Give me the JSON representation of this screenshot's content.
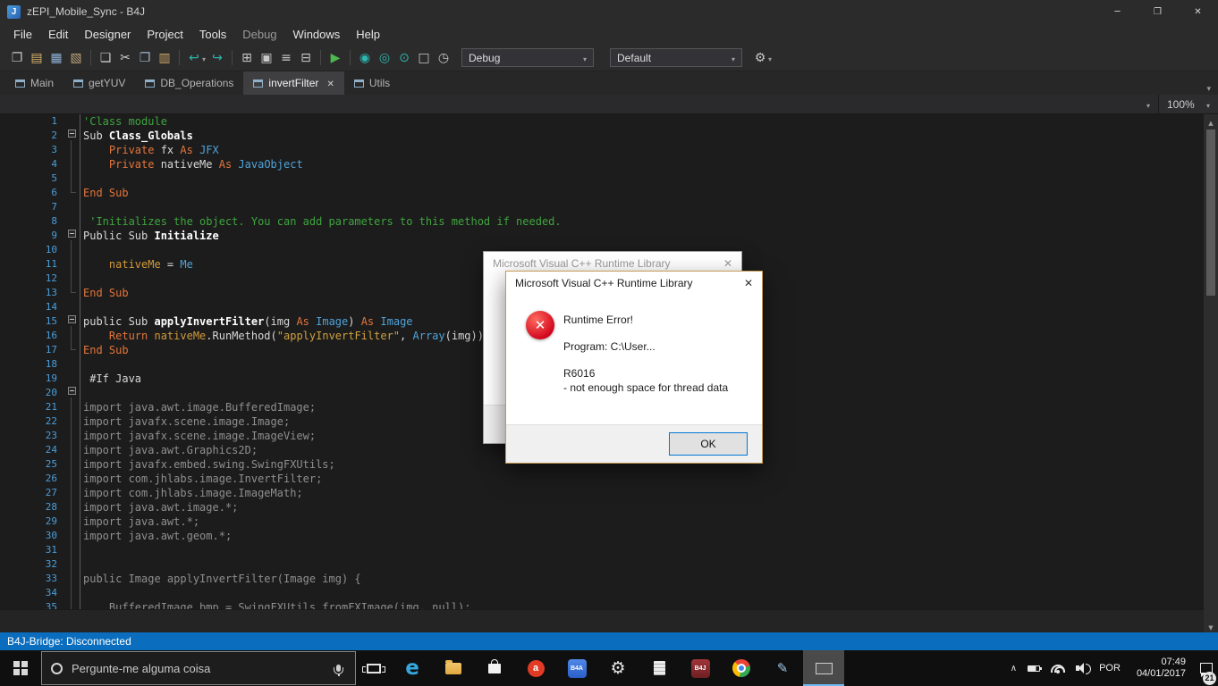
{
  "window": {
    "title": "zEPI_Mobile_Sync - B4J",
    "icon_letter": "J",
    "controls": [
      {
        "name": "minimize-icon",
        "glyph": "─"
      },
      {
        "name": "restore-icon",
        "glyph": "❐"
      },
      {
        "name": "close-icon",
        "glyph": "✕"
      }
    ]
  },
  "menu": {
    "items": [
      {
        "label": "File"
      },
      {
        "label": "Edit"
      },
      {
        "label": "Designer"
      },
      {
        "label": "Project"
      },
      {
        "label": "Tools"
      },
      {
        "label": "Debug",
        "dimmed": true
      },
      {
        "label": "Windows"
      },
      {
        "label": "Help"
      }
    ]
  },
  "toolbar": {
    "debug_value": "Debug",
    "default_value": "Default",
    "left": [
      {
        "name": "new-project-icon",
        "glyph": "❐",
        "color": "#c8c8c8"
      },
      {
        "name": "open-project-icon",
        "glyph": "▤",
        "color": "#d9b26a"
      },
      {
        "name": "save-icon",
        "glyph": "▦",
        "color": "#8fb3d9"
      },
      {
        "name": "export-icon",
        "glyph": "▧",
        "color": "#bda57a"
      },
      {
        "sep": true
      },
      {
        "name": "modules-icon",
        "glyph": "❏",
        "color": "#c8c8c8"
      },
      {
        "name": "cut-icon",
        "glyph": "✂",
        "color": "#cfcfcf"
      },
      {
        "name": "copy-icon",
        "glyph": "❐",
        "color": "#9fb6cc"
      },
      {
        "name": "paste-icon",
        "glyph": "▥",
        "color": "#cfa96a"
      },
      {
        "sep": true
      },
      {
        "name": "navigate-back-icon",
        "glyph": "↩",
        "color": "#2fb5ae",
        "caret": true
      },
      {
        "name": "navigate-forward-icon",
        "glyph": "↪",
        "color": "#2fb5ae"
      },
      {
        "sep": true
      },
      {
        "name": "designer-icon",
        "glyph": "⊞",
        "color": "#c8c8c8"
      },
      {
        "name": "layout-icon",
        "glyph": "▣",
        "color": "#c8c8c8"
      },
      {
        "name": "logs-icon",
        "glyph": "≡",
        "color": "#c8c8c8"
      },
      {
        "name": "compile-icon",
        "glyph": "⊟",
        "color": "#c8c8c8"
      },
      {
        "sep": true
      },
      {
        "name": "run-icon",
        "glyph": "▶",
        "color": "#4db84d"
      },
      {
        "sep": true
      },
      {
        "name": "bridge-icon",
        "glyph": "◉",
        "color": "#2fb5ae"
      },
      {
        "name": "connect-icon",
        "glyph": "◎",
        "color": "#2fb5ae"
      },
      {
        "name": "wireless-icon",
        "glyph": "⊙",
        "color": "#2fb5ae"
      },
      {
        "name": "stop-icon",
        "glyph": "□",
        "color": "#c8c8c8"
      },
      {
        "name": "profiler-icon",
        "glyph": "◷",
        "color": "#c8c8c8"
      }
    ],
    "right": [
      {
        "name": "tools-gear-icon",
        "glyph": "⚙",
        "color": "#c8c8c8",
        "caret": true
      }
    ]
  },
  "tabs": [
    {
      "label": "Main"
    },
    {
      "label": "getYUV"
    },
    {
      "label": "DB_Operations"
    },
    {
      "label": "invertFilter",
      "active": true,
      "closable": true
    },
    {
      "label": "Utils"
    }
  ],
  "navbar": {
    "zoom": "100%"
  },
  "editor": {
    "fold_guides": [
      {
        "from": 2,
        "to": 6
      },
      {
        "from": 9,
        "to": 13
      },
      {
        "from": 15,
        "to": 17
      },
      {
        "from": 20
      }
    ],
    "lines": [
      {
        "n": 1,
        "s": [
          [
            "cm",
            "'Class module"
          ]
        ]
      },
      {
        "n": 2,
        "fold": true,
        "s": [
          [
            "pl",
            "Sub "
          ],
          [
            "bd",
            "Class_Globals"
          ]
        ]
      },
      {
        "n": 3,
        "s": [
          [
            "pl",
            "    "
          ],
          [
            "kw",
            "Private "
          ],
          [
            "pl",
            "fx "
          ],
          [
            "kw",
            "As "
          ],
          [
            "ty",
            "JFX"
          ]
        ]
      },
      {
        "n": 4,
        "s": [
          [
            "pl",
            "    "
          ],
          [
            "kw",
            "Private "
          ],
          [
            "pl",
            "nativeMe "
          ],
          [
            "kw",
            "As "
          ],
          [
            "ty",
            "JavaObject"
          ]
        ]
      },
      {
        "n": 5,
        "s": []
      },
      {
        "n": 6,
        "s": [
          [
            "kw",
            "End Sub"
          ]
        ]
      },
      {
        "n": 7,
        "s": []
      },
      {
        "n": 8,
        "s": [
          [
            "cm",
            " 'Initializes the object. You can add parameters to this method if needed."
          ]
        ]
      },
      {
        "n": 9,
        "fold": true,
        "s": [
          [
            "pl",
            "Public Sub "
          ],
          [
            "bd",
            "Initialize"
          ]
        ]
      },
      {
        "n": 10,
        "s": []
      },
      {
        "n": 11,
        "s": [
          [
            "pl",
            "    "
          ],
          [
            "mb",
            "nativeMe"
          ],
          [
            "pl",
            " = "
          ],
          [
            "ty",
            "Me"
          ]
        ]
      },
      {
        "n": 12,
        "s": []
      },
      {
        "n": 13,
        "s": [
          [
            "kw",
            "End Sub"
          ]
        ]
      },
      {
        "n": 14,
        "s": []
      },
      {
        "n": 15,
        "fold": true,
        "s": [
          [
            "pl",
            "public Sub "
          ],
          [
            "bd",
            "applyInvertFilter"
          ],
          [
            "pl",
            "(img "
          ],
          [
            "kw",
            "As "
          ],
          [
            "ty",
            "Image"
          ],
          [
            "pl",
            ") "
          ],
          [
            "kw",
            "As "
          ],
          [
            "ty",
            "Image"
          ]
        ]
      },
      {
        "n": 16,
        "s": [
          [
            "pl",
            "    "
          ],
          [
            "kw",
            "Return "
          ],
          [
            "mb",
            "nativeMe"
          ],
          [
            "pl",
            ".RunMethod("
          ],
          [
            "str",
            "\"applyInvertFilter\""
          ],
          [
            "pl",
            ", "
          ],
          [
            "ty",
            "Array"
          ],
          [
            "pl",
            "(img))"
          ]
        ]
      },
      {
        "n": 17,
        "s": [
          [
            "kw",
            "End Sub"
          ]
        ]
      },
      {
        "n": 18,
        "s": []
      },
      {
        "n": 19,
        "s": [
          [
            "pl",
            " #If Java"
          ]
        ]
      },
      {
        "n": 20,
        "fold": true,
        "s": []
      },
      {
        "n": 21,
        "s": [
          [
            "jv",
            "import java.awt.image.BufferedImage;"
          ]
        ]
      },
      {
        "n": 22,
        "s": [
          [
            "jv",
            "import javafx.scene.image.Image;"
          ]
        ]
      },
      {
        "n": 23,
        "s": [
          [
            "jv",
            "import javafx.scene.image.ImageView;"
          ]
        ]
      },
      {
        "n": 24,
        "s": [
          [
            "jv",
            "import java.awt.Graphics2D;"
          ]
        ]
      },
      {
        "n": 25,
        "s": [
          [
            "jv",
            "import javafx.embed.swing.SwingFXUtils;"
          ]
        ]
      },
      {
        "n": 26,
        "s": [
          [
            "jv",
            "import com.jhlabs.image.InvertFilter;"
          ]
        ]
      },
      {
        "n": 27,
        "s": [
          [
            "jv",
            "import com.jhlabs.image.ImageMath;"
          ]
        ]
      },
      {
        "n": 28,
        "s": [
          [
            "jv",
            "import java.awt.image.*;"
          ]
        ]
      },
      {
        "n": 29,
        "s": [
          [
            "jv",
            "import java.awt.*;"
          ]
        ]
      },
      {
        "n": 30,
        "s": [
          [
            "jv",
            "import java.awt.geom.*;"
          ]
        ]
      },
      {
        "n": 31,
        "s": []
      },
      {
        "n": 32,
        "s": []
      },
      {
        "n": 33,
        "s": [
          [
            "jv",
            "public Image applyInvertFilter(Image img) {"
          ]
        ]
      },
      {
        "n": 34,
        "s": []
      },
      {
        "n": 35,
        "s": [
          [
            "jv",
            "    BufferedImage bmp = SwingFXUtils.fromFXImage(img, null);"
          ]
        ]
      }
    ]
  },
  "dialogs": {
    "back": {
      "title": "Microsoft Visual C++ Runtime Library"
    },
    "front": {
      "title": "Microsoft Visual C++ Runtime Library",
      "lines": [
        "Runtime Error!",
        "Program: C:\\User...",
        "R6016",
        "- not enough space for thread data"
      ],
      "ok_label": "OK"
    }
  },
  "statusbar": {
    "text": "B4J-Bridge: Disconnected"
  },
  "taskbar": {
    "search_text": "Pergunte-me alguma coisa",
    "apps": [
      {
        "name": "edge",
        "cls": "ico-edge",
        "glyph": "e"
      },
      {
        "name": "file-explorer",
        "cls": "ico-folder"
      },
      {
        "name": "store",
        "cls": "ico-bag"
      },
      {
        "name": "app-a",
        "cls": "ico-reda",
        "glyph": "a"
      },
      {
        "name": "b4a",
        "cls": "ico-b4a",
        "glyph": "B4A"
      },
      {
        "name": "settings",
        "cls": "ico-gear",
        "glyph": "⚙"
      },
      {
        "name": "notes",
        "cls": "ico-page"
      },
      {
        "name": "b4j",
        "cls": "ico-b4j",
        "glyph": "B4J"
      },
      {
        "name": "chrome",
        "cls": "ico-chrome"
      },
      {
        "name": "pen",
        "cls": "ico-pen",
        "glyph": "✎"
      },
      {
        "name": "active-window",
        "cls": "ico-monitor",
        "active": true
      }
    ],
    "tray": {
      "lang": "POR",
      "time": "07:49",
      "date": "04/01/2017",
      "badge": "21"
    }
  },
  "colors": {
    "status_blue": "#0b6dbd",
    "error_red": "#d0021b",
    "teal_accent": "#2fb5ae",
    "line_number_blue": "#4a9edb"
  }
}
